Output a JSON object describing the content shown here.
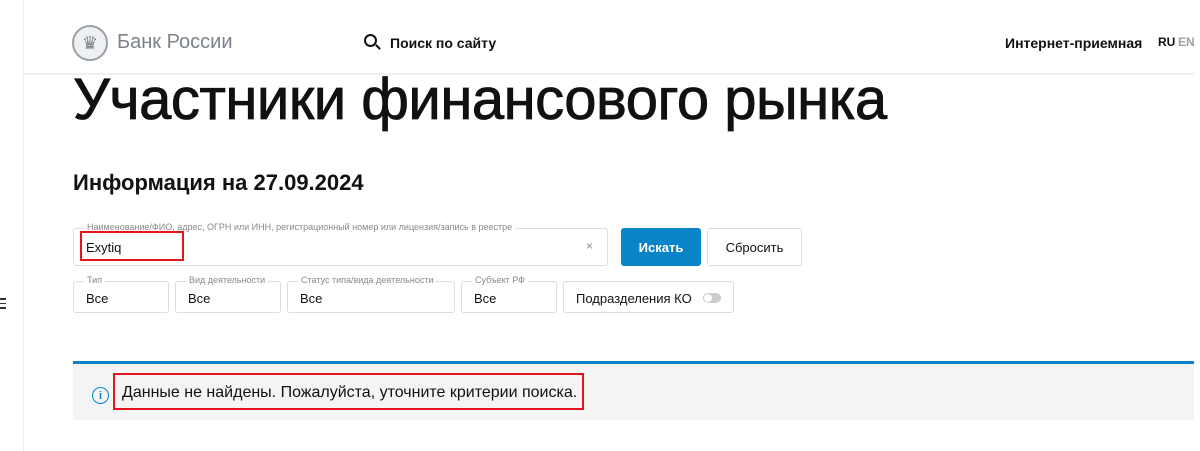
{
  "header": {
    "brand": "Банк России",
    "search_label": "Поиск по сайту",
    "reception": "Интернет-приемная",
    "lang_ru": "RU",
    "lang_en": "EN"
  },
  "page": {
    "title": "Участники финансового рынка",
    "subtitle": "Информация на 27.09.2024"
  },
  "search": {
    "label": "Наименование/ФИО, адрес, ОГРН или ИНН, регистрационный номер или лицензия/запись в реестре",
    "value": "Exytiq",
    "clear": "×",
    "submit": "Искать",
    "reset": "Сбросить"
  },
  "filters": [
    {
      "label": "Тип",
      "value": "Все"
    },
    {
      "label": "Вид деятельности",
      "value": "Все"
    },
    {
      "label": "Статус типа/вида деятельности",
      "value": "Все"
    },
    {
      "label": "Субъект РФ",
      "value": "Все"
    }
  ],
  "toggle": {
    "label": "Подразделения КО",
    "on": false
  },
  "result": {
    "message": "Данные не найдены. Пожалуйста, уточните критерии поиска.",
    "icon": "i"
  },
  "colors": {
    "accent": "#0a84c9",
    "highlight": "#e3141b"
  }
}
